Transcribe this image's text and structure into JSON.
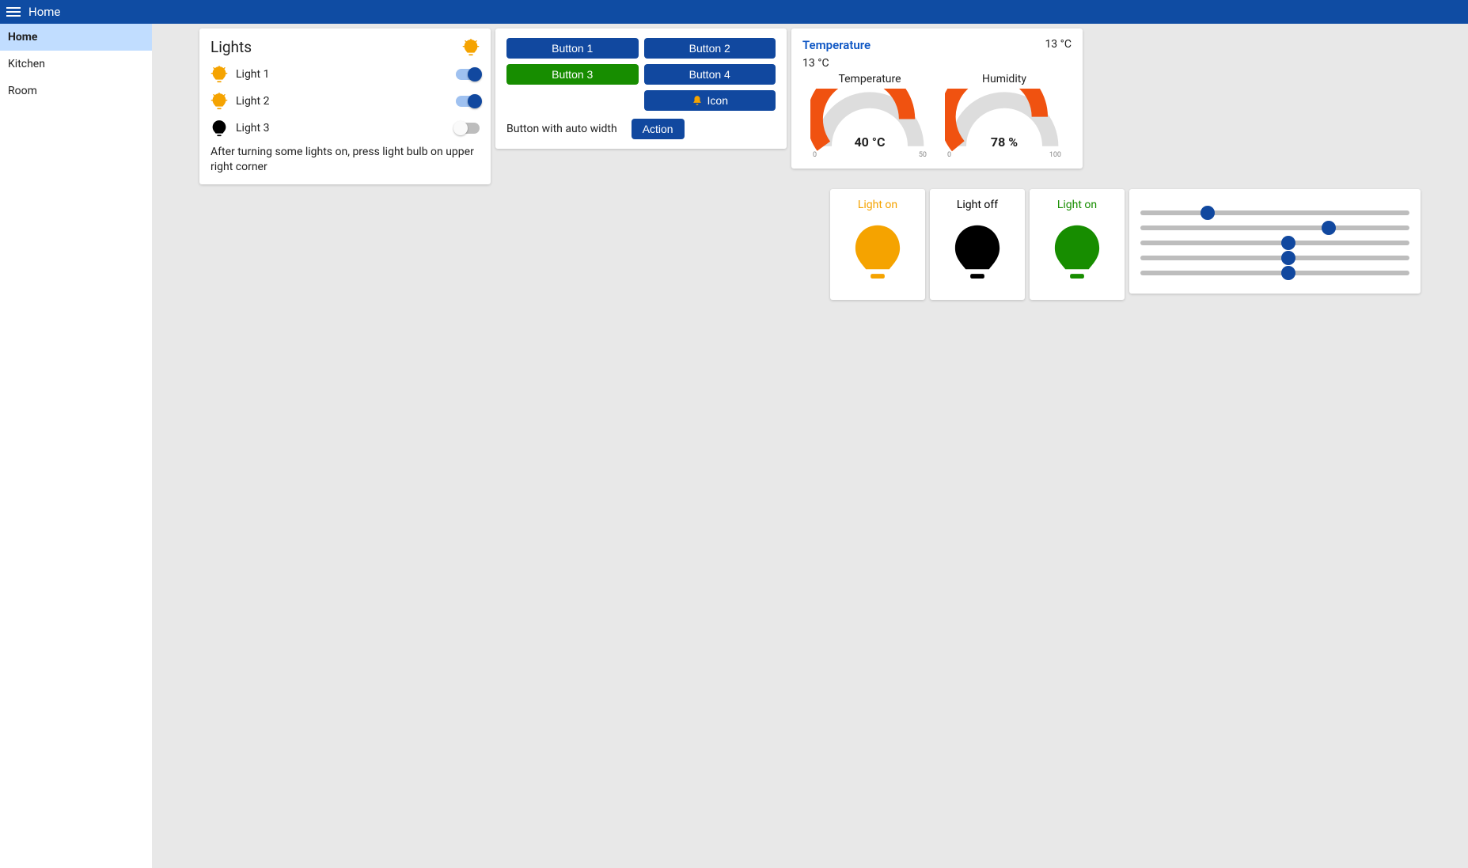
{
  "topbar": {
    "title": "Home"
  },
  "sidebar": {
    "items": [
      {
        "label": "Home",
        "active": true
      },
      {
        "label": "Kitchen",
        "active": false
      },
      {
        "label": "Room",
        "active": false
      }
    ]
  },
  "lights_card": {
    "title": "Lights",
    "items": [
      {
        "name": "Light 1",
        "on": true
      },
      {
        "name": "Light 2",
        "on": true
      },
      {
        "name": "Light 3",
        "on": false
      }
    ],
    "hint": "After turning some lights on, press light bulb on upper right corner"
  },
  "buttons_card": {
    "buttons": [
      {
        "label": "Button 1",
        "color": "blue"
      },
      {
        "label": "Button 2",
        "color": "blue"
      },
      {
        "label": "Button 3",
        "color": "green"
      },
      {
        "label": "Button 4",
        "color": "blue"
      },
      {
        "label": "Icon",
        "color": "blue",
        "icon": "bell"
      }
    ],
    "auto_label": "Button with auto width",
    "action_label": "Action"
  },
  "temp_card": {
    "title": "Temperature",
    "value_display": "13 °C",
    "subtitle": "13 °C",
    "gauges": [
      {
        "label": "Temperature",
        "value_display": "40 °C",
        "fraction": 0.8,
        "min": "0",
        "max": "50"
      },
      {
        "label": "Humidity",
        "value_display": "78 %",
        "fraction": 0.78,
        "min": "0",
        "max": "100"
      }
    ]
  },
  "tiles": [
    {
      "title": "Light on",
      "state": "on",
      "color": "#f5a300"
    },
    {
      "title": "Light off",
      "state": "off",
      "color": "#000000"
    },
    {
      "title": "Light on",
      "state": "green",
      "color": "#178d00"
    }
  ],
  "sliders": {
    "values": [
      25,
      70,
      55,
      55,
      55
    ]
  }
}
